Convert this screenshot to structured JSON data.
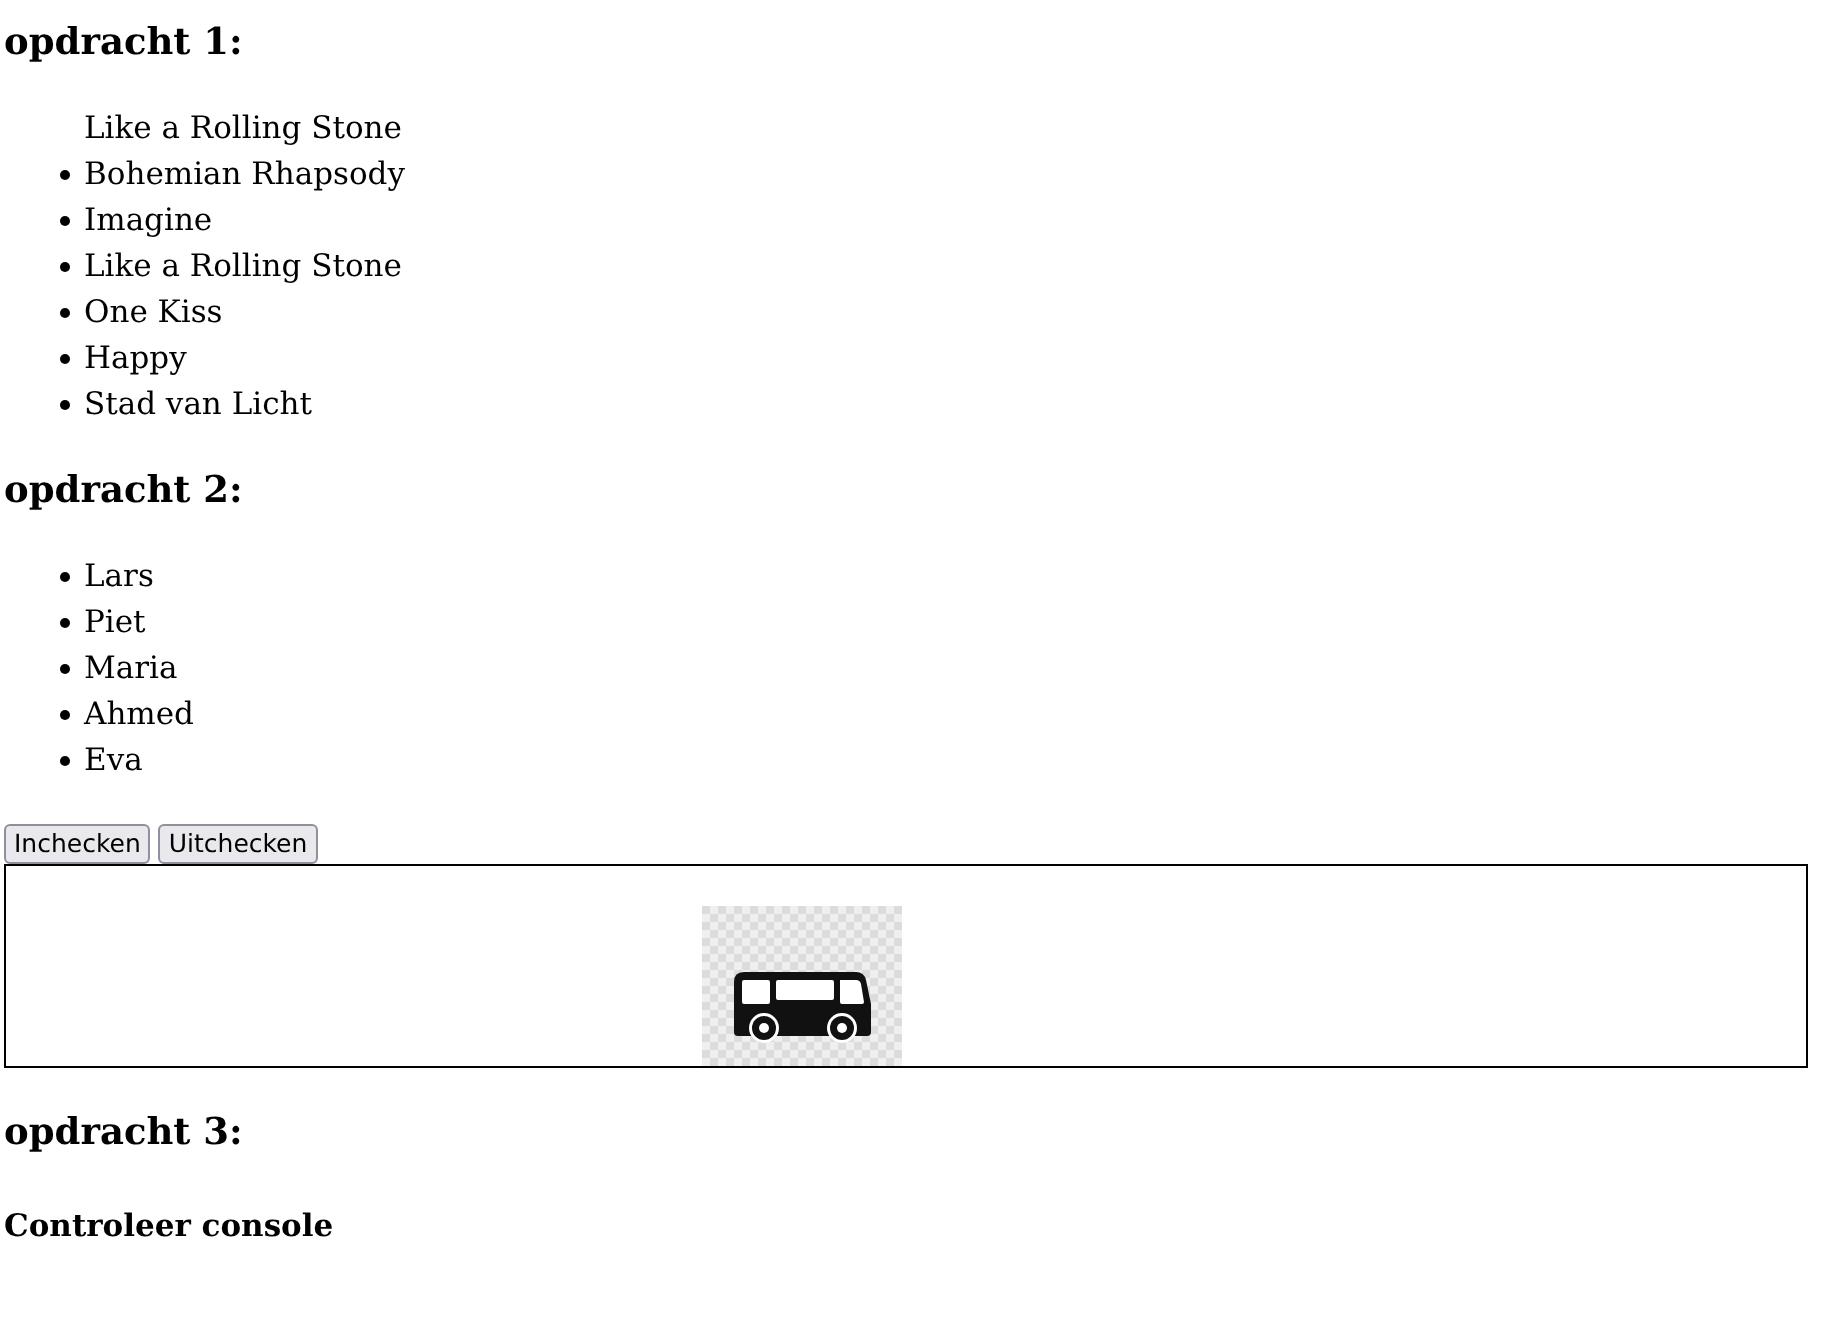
{
  "opdracht_1": {
    "heading": "opdracht 1:",
    "songs": [
      {
        "kind": "plain",
        "text": "Like a Rolling Stone"
      },
      {
        "kind": "bullet",
        "text": "Bohemian Rhapsody"
      },
      {
        "kind": "bullet",
        "text": "Imagine"
      },
      {
        "kind": "bullet",
        "text": "Like a Rolling Stone"
      },
      {
        "kind": "bullet",
        "text": "One Kiss"
      },
      {
        "kind": "bullet",
        "text": "Happy"
      },
      {
        "kind": "bullet",
        "text": "Stad van Licht"
      }
    ]
  },
  "opdracht_2": {
    "heading": "opdracht 2:",
    "names": [
      {
        "kind": "bullet",
        "text": "Lars"
      },
      {
        "kind": "bullet",
        "text": "Piet"
      },
      {
        "kind": "bullet",
        "text": "Maria"
      },
      {
        "kind": "bullet",
        "text": "Ahmed"
      },
      {
        "kind": "bullet",
        "text": "Eva"
      }
    ],
    "buttons": [
      "Inchecken",
      "Uitchecken"
    ]
  },
  "opdracht_3": {
    "heading": "opdracht 3:",
    "subheading": "Controleer console"
  }
}
